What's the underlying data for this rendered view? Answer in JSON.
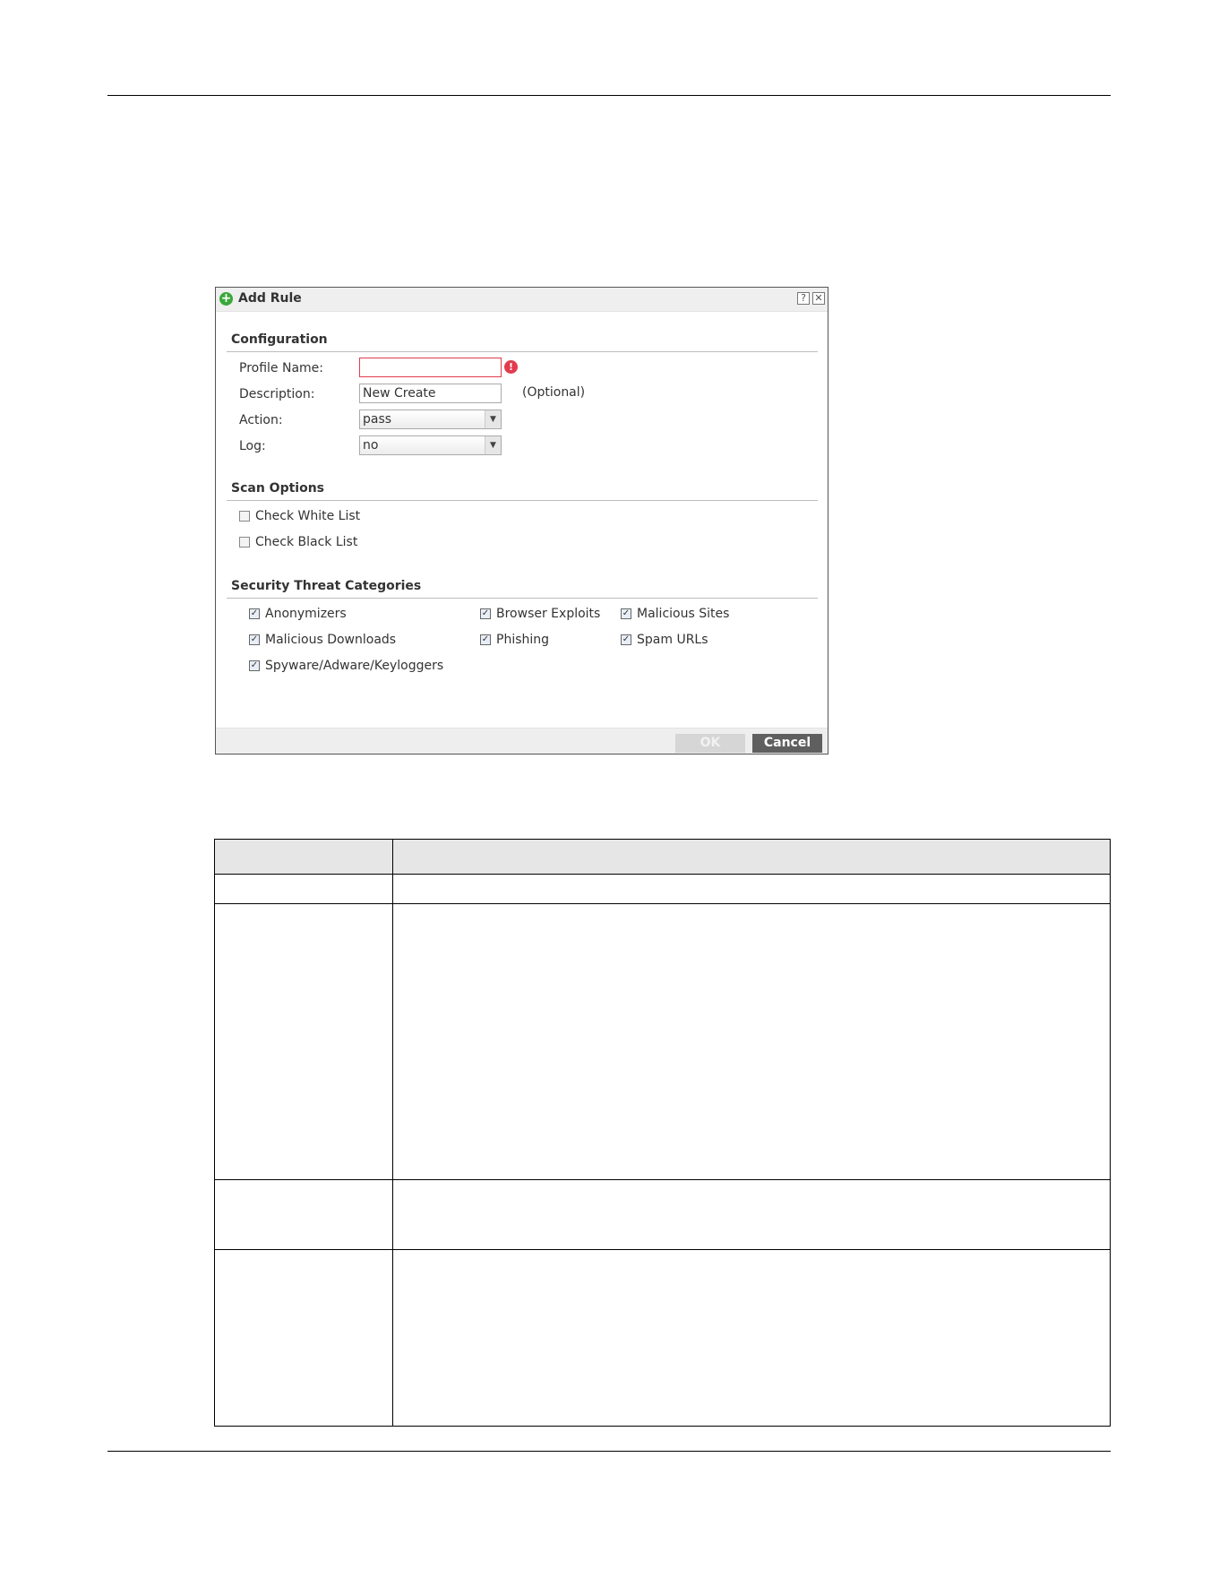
{
  "dialog": {
    "title": "Add Rule",
    "help_glyph": "?",
    "close_glyph": "✕",
    "configuration": {
      "heading": "Configuration",
      "profile_name_label": "Profile Name:",
      "profile_name_value": "",
      "error_glyph": "!",
      "description_label": "Description:",
      "description_value": "New Create",
      "optional_note": "(Optional)",
      "action_label": "Action:",
      "action_value": "pass",
      "log_label": "Log:",
      "log_value": "no"
    },
    "scan_options": {
      "heading": "Scan Options",
      "check_white_list": {
        "label": "Check White List",
        "checked": false
      },
      "check_black_list": {
        "label": "Check Black List",
        "checked": false
      }
    },
    "threat_categories": {
      "heading": "Security Threat Categories",
      "anonymizers": {
        "label": "Anonymizers",
        "checked": true
      },
      "browser_exploits": {
        "label": "Browser Exploits",
        "checked": true
      },
      "malicious_sites": {
        "label": "Malicious Sites",
        "checked": true
      },
      "malicious_downloads": {
        "label": "Malicious Downloads",
        "checked": true
      },
      "phishing": {
        "label": "Phishing",
        "checked": true
      },
      "spam_urls": {
        "label": "Spam URLs",
        "checked": true
      },
      "spyware": {
        "label": "Spyware/Adware/Keyloggers",
        "checked": true
      }
    },
    "buttons": {
      "ok_label": "OK",
      "cancel_label": "Cancel"
    }
  },
  "check_glyph": "✓"
}
